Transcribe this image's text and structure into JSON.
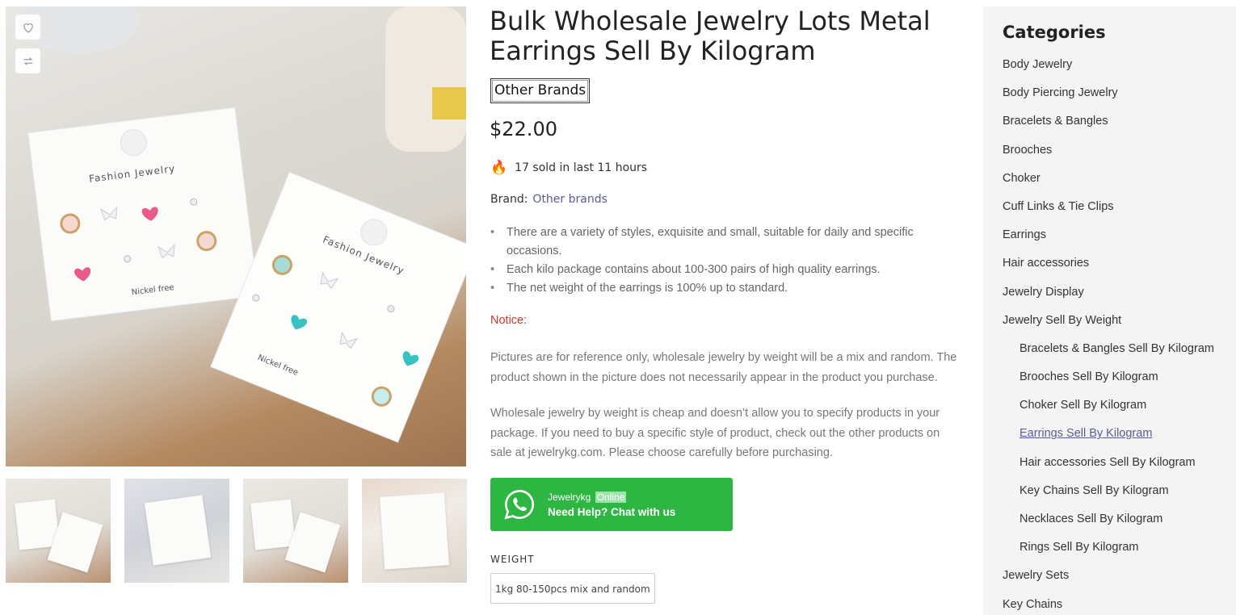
{
  "product": {
    "title": "Bulk Wholesale Jewelry Lots Metal Earrings Sell By Kilogram",
    "brand_badge": "Other Brands",
    "price": "$22.00",
    "sold_text": "17 sold in last 11 hours",
    "brand_label": "Brand:",
    "brand_link": "Other brands",
    "bullets": [
      "There are a variety of styles, exquisite and small, suitable for daily and specific occasions.",
      "Each kilo package contains about 100-300 pairs of high quality earrings.",
      "The net weight of the earrings is 100% up to standard."
    ],
    "notice_label": "Notice:",
    "paragraph_1": "Pictures are for reference only, wholesale jewelry by weight will be a mix and random. The product shown in the picture does not necessarily appear in the product you purchase.",
    "paragraph_2": "Wholesale jewelry by weight is cheap and doesn’t allow you to specify products in your package. If you need to buy a specific style of product, check out the other products on sale at jewelrykg.com. Please choose carefully before purchasing."
  },
  "chat": {
    "agent_name": "Jewelrykg",
    "status": "Online",
    "cta": "Need Help? Chat with us"
  },
  "variation": {
    "label": "WEIGHT",
    "option": "1kg 80-150pcs mix and random"
  },
  "gallery": {
    "main_card_label_1": "Fashion Jewelry",
    "main_card_label_2": "Fashion Jewelry",
    "main_card_footer_1": "Nickel free",
    "main_card_footer_2": "Nickel free"
  },
  "sidebar": {
    "title": "Categories",
    "items": [
      {
        "label": "Body Jewelry",
        "level": 0
      },
      {
        "label": "Body Piercing Jewelry",
        "level": 0
      },
      {
        "label": "Bracelets & Bangles",
        "level": 0
      },
      {
        "label": "Brooches",
        "level": 0
      },
      {
        "label": "Choker",
        "level": 0
      },
      {
        "label": "Cuff Links & Tie Clips",
        "level": 0
      },
      {
        "label": "Earrings",
        "level": 0
      },
      {
        "label": "Hair accessories",
        "level": 0
      },
      {
        "label": "Jewelry Display",
        "level": 0
      },
      {
        "label": "Jewelry Sell By Weight",
        "level": 0
      },
      {
        "label": "Bracelets & Bangles Sell By Kilogram",
        "level": 1
      },
      {
        "label": "Brooches Sell By Kilogram",
        "level": 1
      },
      {
        "label": "Choker Sell By Kilogram",
        "level": 1
      },
      {
        "label": "Earrings Sell By Kilogram",
        "level": 1,
        "active": true
      },
      {
        "label": "Hair accessories Sell By Kilogram",
        "level": 1
      },
      {
        "label": "Key Chains Sell By Kilogram",
        "level": 1
      },
      {
        "label": "Necklaces Sell By Kilogram",
        "level": 1
      },
      {
        "label": "Rings Sell By Kilogram",
        "level": 1
      },
      {
        "label": "Jewelry Sets",
        "level": 0
      },
      {
        "label": "Key Chains",
        "level": 0
      }
    ]
  },
  "colors": {
    "chat_green": "#2db742",
    "link_purple": "#5b5b9a",
    "notice_red": "#c0392b",
    "sidebar_bg": "#f4f4f4"
  }
}
